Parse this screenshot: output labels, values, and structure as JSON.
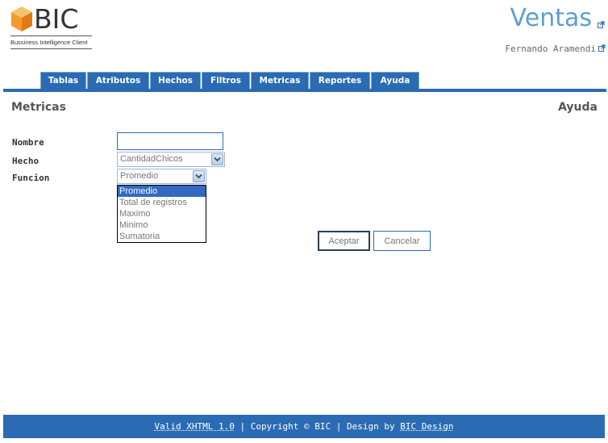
{
  "logo": {
    "text": "BIC",
    "subtitle": "Bussiness Intelligence Client"
  },
  "header": {
    "title": "Ventas",
    "user": "Fernando Aramendi"
  },
  "nav": {
    "tabs": [
      {
        "label": "Tablas"
      },
      {
        "label": "Atributos"
      },
      {
        "label": "Hechos"
      },
      {
        "label": "Filtros"
      },
      {
        "label": "Metricas"
      },
      {
        "label": "Reportes"
      },
      {
        "label": "Ayuda"
      }
    ]
  },
  "page": {
    "title": "Metricas",
    "help": "Ayuda"
  },
  "form": {
    "nombre": {
      "label": "Nombre",
      "value": ""
    },
    "hecho": {
      "label": "Hecho",
      "value": "CantidadChicos"
    },
    "funcion": {
      "label": "Funcion",
      "value": "Promedio",
      "options": [
        "Promedio",
        "Total de registros",
        "Maximo",
        "Minimo",
        "Sumatoria"
      ]
    },
    "accept": "Aceptar",
    "cancel": "Cancelar"
  },
  "footer": {
    "valid": "Valid XHTML 1.0",
    "sep1": " | ",
    "copyright": "Copyright © BIC",
    "sep2": " | ",
    "design": "Design by ",
    "designer": "BIC Design"
  },
  "colors": {
    "brand": "#2a6bb3",
    "title": "#5d9fd6",
    "selected": "#316ac5"
  }
}
